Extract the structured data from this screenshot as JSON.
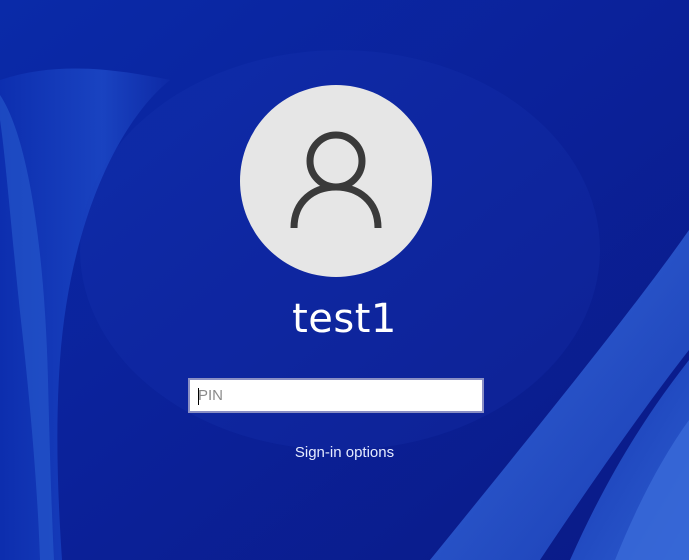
{
  "lock_screen": {
    "user": {
      "name": "test1",
      "avatar_icon": "user-silhouette-icon"
    },
    "pin_field": {
      "placeholder": "PIN",
      "value": ""
    },
    "sign_in_options_label": "Sign-in options"
  },
  "colors": {
    "background_deep": "#0a1f9a",
    "background_mid": "#1234b8",
    "ribbon_light": "#2c55c9",
    "avatar_bg": "#e6e6e6",
    "avatar_glyph": "#3a3a3a",
    "text": "#ffffff"
  }
}
